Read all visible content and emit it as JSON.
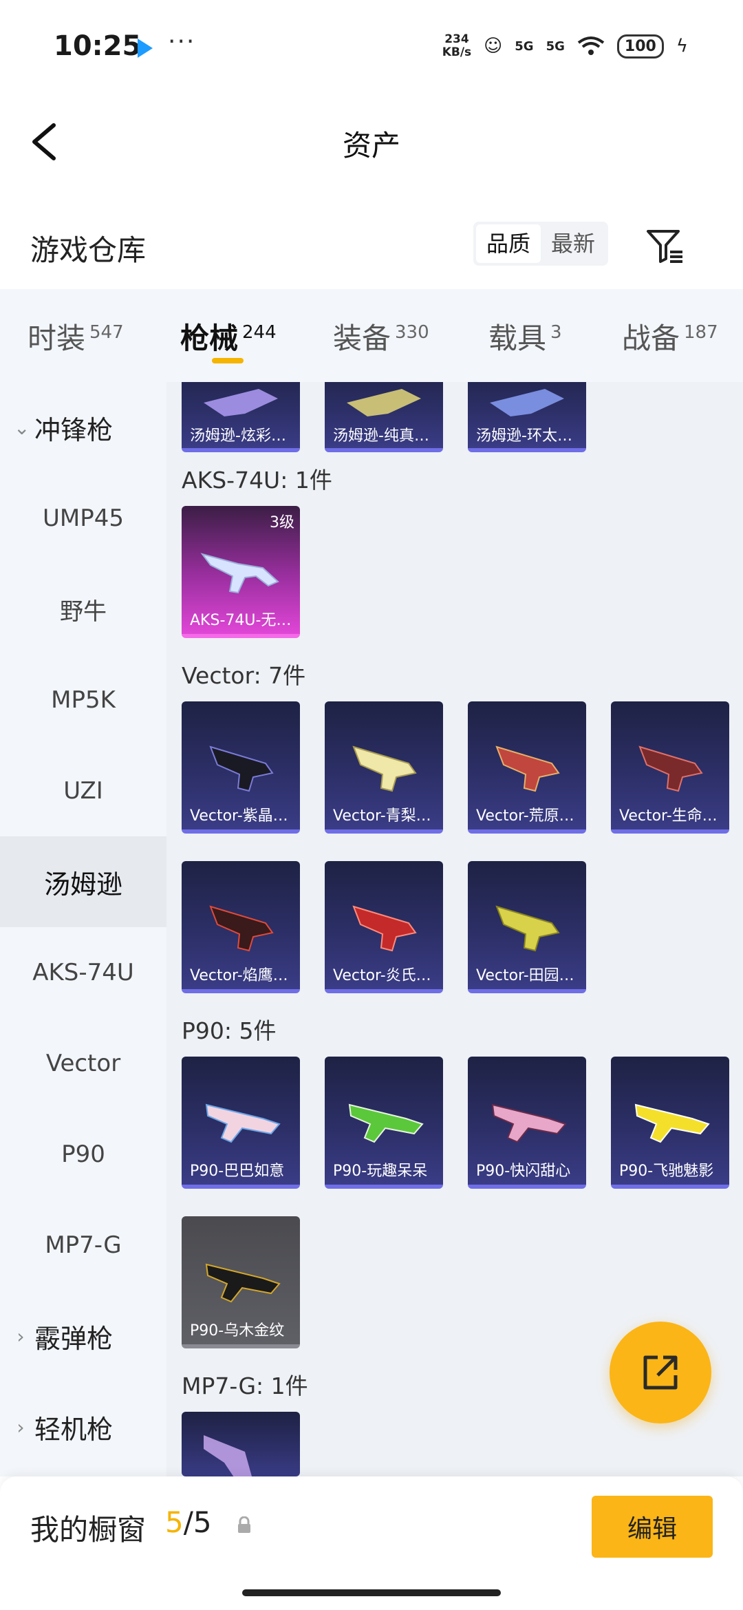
{
  "status_bar": {
    "time": "10:25",
    "dots": "···",
    "speed_value": "234",
    "speed_unit": "KB/s",
    "signal1": "5G",
    "signal2": "5G",
    "battery": "100"
  },
  "nav": {
    "title": "资产"
  },
  "header": {
    "title": "游戏仓库",
    "sort_options": [
      "品质",
      "最新"
    ],
    "sort_selected": "品质"
  },
  "tabs": [
    {
      "label": "时装",
      "count": "547"
    },
    {
      "label": "枪械",
      "count": "244"
    },
    {
      "label": "装备",
      "count": "330"
    },
    {
      "label": "载具",
      "count": "3"
    },
    {
      "label": "战备",
      "count": "187"
    }
  ],
  "sidebar": {
    "group_expanded": "冲锋枪",
    "items": [
      "UMP45",
      "野牛",
      "MP5K",
      "UZI",
      "汤姆逊",
      "AKS-74U",
      "Vector",
      "P90",
      "MP7-G"
    ],
    "selected": "汤姆逊",
    "groups_collapsed": [
      "霰弹枪",
      "轻机枪"
    ]
  },
  "sections": [
    {
      "title": "",
      "items": [
        {
          "name": "汤姆逊-炫彩…"
        },
        {
          "name": "汤姆逊-纯真…"
        },
        {
          "name": "汤姆逊-环太…"
        }
      ]
    },
    {
      "title": "AKS-74U: 1件",
      "items": [
        {
          "name": "AKS-74U-无…",
          "level": "3级"
        }
      ]
    },
    {
      "title": "Vector: 7件",
      "items": [
        {
          "name": "Vector-紫晶…"
        },
        {
          "name": "Vector-青梨…"
        },
        {
          "name": "Vector-荒原…"
        },
        {
          "name": "Vector-生命…"
        },
        {
          "name": "Vector-焰鹰…"
        },
        {
          "name": "Vector-炎氏…"
        },
        {
          "name": "Vector-田园…"
        }
      ]
    },
    {
      "title": "P90: 5件",
      "items": [
        {
          "name": "P90-巴巴如意"
        },
        {
          "name": "P90-玩趣呆呆"
        },
        {
          "name": "P90-快闪甜心"
        },
        {
          "name": "P90-飞驰魅影"
        },
        {
          "name": "P90-乌木金纹"
        }
      ]
    },
    {
      "title": "MP7-G: 1件",
      "items": []
    }
  ],
  "bottom": {
    "label": "我的橱窗",
    "current": "5",
    "separator": "/",
    "total": "5",
    "edit_label": "编辑"
  },
  "colors": {
    "accent": "#fbb516",
    "card_blue": "#2c2f66",
    "card_pink": "#e046d6"
  }
}
